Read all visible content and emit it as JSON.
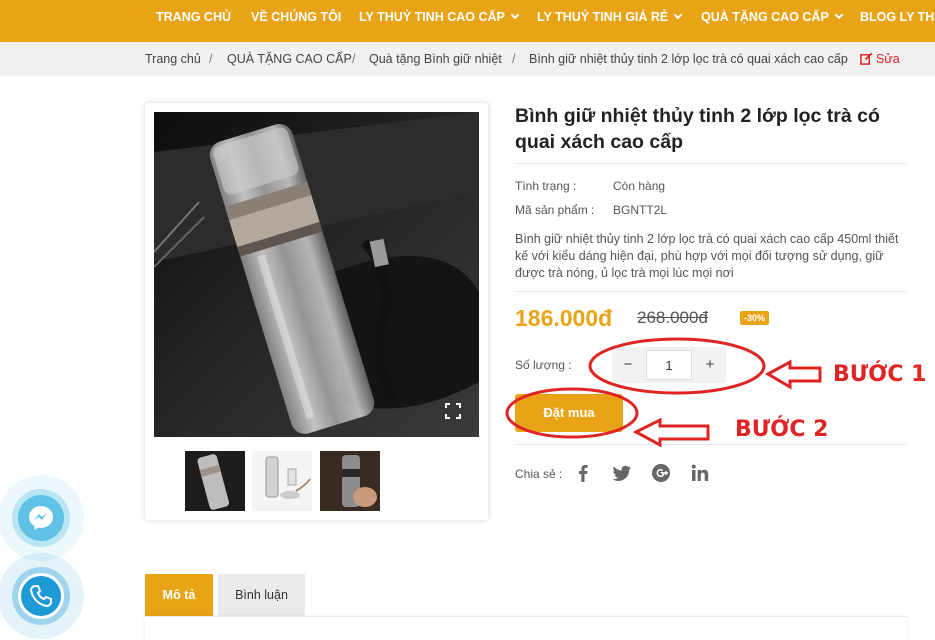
{
  "nav": {
    "items": [
      {
        "label": "TRANG CHỦ",
        "dropdown": false
      },
      {
        "label": "VỀ CHÚNG TÔI",
        "dropdown": false
      },
      {
        "label": "LY THUỶ TINH CAO CẤP",
        "dropdown": true
      },
      {
        "label": "LY THUỶ TINH GIÁ RẺ",
        "dropdown": true
      },
      {
        "label": "QUÀ TẶNG CAO CẤP",
        "dropdown": true
      },
      {
        "label": "BLOG LY THU",
        "dropdown": false
      }
    ]
  },
  "breadcrumb": {
    "items": [
      "Trang chủ",
      "QUÀ TẶNG CAO CẤP",
      "Quà tặng Bình giữ nhiệt",
      "Bình giữ nhiệt thủy tinh 2 lớp lọc trà có quai xách cao cấp"
    ],
    "separator": "/",
    "edit_label": "Sửa"
  },
  "product": {
    "title": "Bình giữ nhiệt thủy tinh 2 lớp lọc trà có quai xách cao cấp",
    "status_label": "Tình trạng :",
    "status_value": "Còn hàng",
    "sku_label": "Mã sản phẩm :",
    "sku_value": "BGNTT2L",
    "description": "Bình giữ nhiệt thủy tinh 2 lớp lọc trà có quai xách cao cấp 450ml thiết kế với kiểu dáng hiện đại, phù hợp với mọi đối tượng sử dụng, giữ được trà nóng, ủ lọc trà mọi lúc mọi nơi",
    "price": "186.000đ",
    "old_price": "268.000đ",
    "discount": "-30%",
    "quantity_label": "Số lượng :",
    "quantity_value": "1",
    "minus_symbol": "−",
    "plus_symbol": "+",
    "buy_label": "Đặt mua",
    "share_label": "Chia sẻ :",
    "share_icons": [
      "facebook-icon",
      "twitter-icon",
      "google-plus-icon",
      "linkedin-icon"
    ]
  },
  "tabs": [
    {
      "label": "Mô tả",
      "active": true
    },
    {
      "label": "Bình luận",
      "active": false
    }
  ],
  "annotations": {
    "step1": "BƯỚC 1",
    "step2": "BƯỚC 2"
  },
  "colors": {
    "accent": "#e8a317",
    "annotation": "#e02424",
    "messenger": "#5fc2e6",
    "phone": "#1e9ad6"
  }
}
